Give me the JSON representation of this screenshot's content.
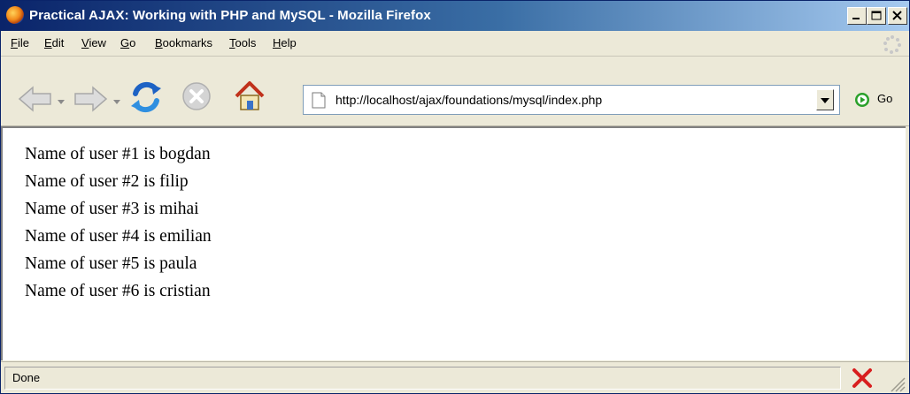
{
  "window": {
    "title": "Practical AJAX: Working with PHP and MySQL - Mozilla Firefox"
  },
  "menu": {
    "items": [
      "File",
      "Edit",
      "View",
      "Go",
      "Bookmarks",
      "Tools",
      "Help"
    ]
  },
  "toolbar": {
    "url": "http://localhost/ajax/foundations/mysql/index.php",
    "go_label": "Go"
  },
  "content": {
    "lines": [
      "Name of user #1 is bogdan",
      "Name of user #2 is filip",
      "Name of user #3 is mihai",
      "Name of user #4 is emilian",
      "Name of user #5 is paula",
      "Name of user #6 is cristian"
    ]
  },
  "status": {
    "text": "Done"
  },
  "icons": {
    "app": "firefox-icon",
    "back": "back-arrow-icon",
    "forward": "forward-arrow-icon",
    "reload": "reload-icon",
    "stop": "stop-icon",
    "home": "home-icon",
    "page": "page-icon",
    "go": "go-icon",
    "status_error": "red-x-icon"
  },
  "colors": {
    "titlebar_start": "#0a246a",
    "titlebar_end": "#a6caf0",
    "chrome": "#ece9d8",
    "go_green": "#2aa02a",
    "error_red": "#d81e1e"
  }
}
